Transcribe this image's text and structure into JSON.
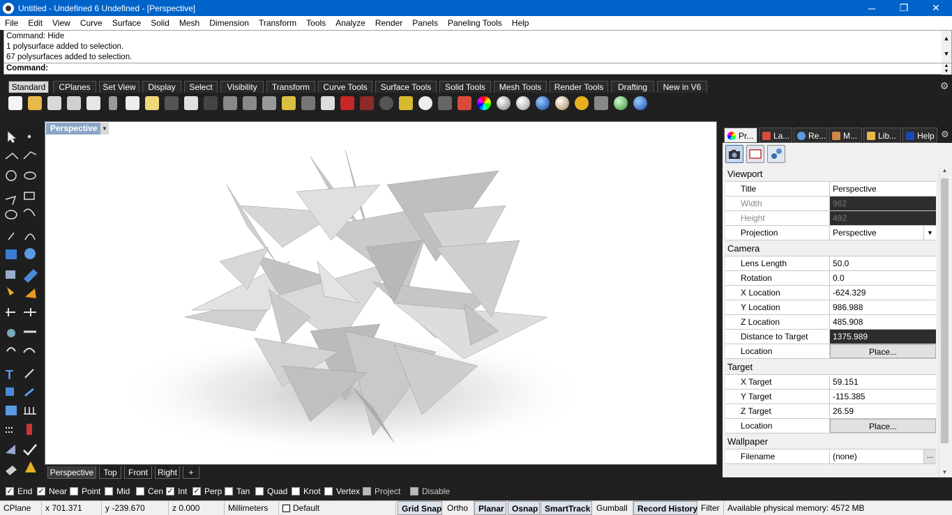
{
  "window": {
    "title": "Untitled - Undefined 6 Undefined - [Perspective]",
    "min": "─",
    "max": "❐",
    "close": "✕"
  },
  "menu": [
    "File",
    "Edit",
    "View",
    "Curve",
    "Surface",
    "Solid",
    "Mesh",
    "Dimension",
    "Transform",
    "Tools",
    "Analyze",
    "Render",
    "Panels",
    "Paneling Tools",
    "Help"
  ],
  "command": {
    "history": [
      "Command: Hide",
      "1 polysurface added to selection.",
      "67 polysurfaces added to selection."
    ],
    "prompt": "Command:"
  },
  "toolbar_tabs": [
    "Standard",
    "CPlanes",
    "Set View",
    "Display",
    "Select",
    "Visibility",
    "Transform",
    "Curve Tools",
    "Surface Tools",
    "Solid Tools",
    "Mesh Tools",
    "Render Tools",
    "Drafting",
    "New in V6"
  ],
  "toolbar_icons": [
    "new-icon",
    "open-icon",
    "save-icon",
    "print-icon",
    "paste-icon",
    "cut-icon",
    "copy-icon",
    "clipboard-icon",
    "undo-icon",
    "pan-icon",
    "move-icon",
    "zoom-icon",
    "zoom-window-icon",
    "zoom-extents-icon",
    "zoom-selected-icon",
    "rotate-view-icon",
    "four-views-icon",
    "car-icon",
    "car2-icon",
    "target-icon",
    "points-icon",
    "light-icon",
    "lock-icon",
    "material-icon",
    "color-wheel-icon",
    "sphere-gray-icon",
    "sphere-white-icon",
    "sphere-blue-icon",
    "sphere-shiny-icon",
    "sun-icon",
    "crop-icon",
    "globe-icon",
    "help-icon"
  ],
  "viewport": {
    "label": "Perspective"
  },
  "view_tabs": [
    "Perspective",
    "Top",
    "Front",
    "Right",
    "+"
  ],
  "panel_tabs": [
    "Pr...",
    "La...",
    "Re...",
    "M...",
    "Lib...",
    "Help"
  ],
  "properties": {
    "viewport": {
      "section": "Viewport",
      "title_label": "Title",
      "title_value": "Perspective",
      "width_label": "Width",
      "width_value": "962",
      "height_label": "Height",
      "height_value": "492",
      "projection_label": "Projection",
      "projection_value": "Perspective"
    },
    "camera": {
      "section": "Camera",
      "lens_label": "Lens Length",
      "lens_value": "50.0",
      "rotation_label": "Rotation",
      "rotation_value": "0.0",
      "xloc_label": "X Location",
      "xloc_value": "-624.329",
      "yloc_label": "Y Location",
      "yloc_value": "986.988",
      "zloc_label": "Z Location",
      "zloc_value": "485.908",
      "dist_label": "Distance to Target",
      "dist_value": "1375.989",
      "location_label": "Location",
      "location_button": "Place..."
    },
    "target": {
      "section": "Target",
      "x_label": "X Target",
      "x_value": "59.151",
      "y_label": "Y Target",
      "y_value": "-115.385",
      "z_label": "Z Target",
      "z_value": "26.59",
      "location_label": "Location",
      "location_button": "Place..."
    },
    "wallpaper": {
      "section": "Wallpaper",
      "filename_label": "Filename",
      "filename_value": "(none)",
      "browse": "..."
    }
  },
  "osnaps": [
    {
      "label": "End",
      "checked": true
    },
    {
      "label": "Near",
      "checked": true
    },
    {
      "label": "Point",
      "checked": false
    },
    {
      "label": "Mid",
      "checked": false
    },
    {
      "label": "Cen",
      "checked": false
    },
    {
      "label": "Int",
      "checked": true
    },
    {
      "label": "Perp",
      "checked": true
    },
    {
      "label": "Tan",
      "checked": false
    },
    {
      "label": "Quad",
      "checked": false
    },
    {
      "label": "Knot",
      "checked": false
    },
    {
      "label": "Vertex",
      "checked": false
    },
    {
      "label": "Project",
      "checked": false
    },
    {
      "label": "Disable",
      "checked": false
    }
  ],
  "status": {
    "cplane": "CPlane",
    "x": "x 701.371",
    "y": "y -239.670",
    "z": "z 0.000",
    "units": "Millimeters",
    "layer": "Default",
    "grid_snap": "Grid Snap",
    "ortho": "Ortho",
    "planar": "Planar",
    "osnap": "Osnap",
    "smarttrack": "SmartTrack",
    "gumball": "Gumball",
    "record_history": "Record History",
    "filter": "Filter",
    "memory": "Available physical memory: 4572 MB"
  },
  "colors": {
    "titlebar": "#0063c9",
    "viewport_label": "#8aa5c6",
    "dark_chrome": "#202020"
  }
}
